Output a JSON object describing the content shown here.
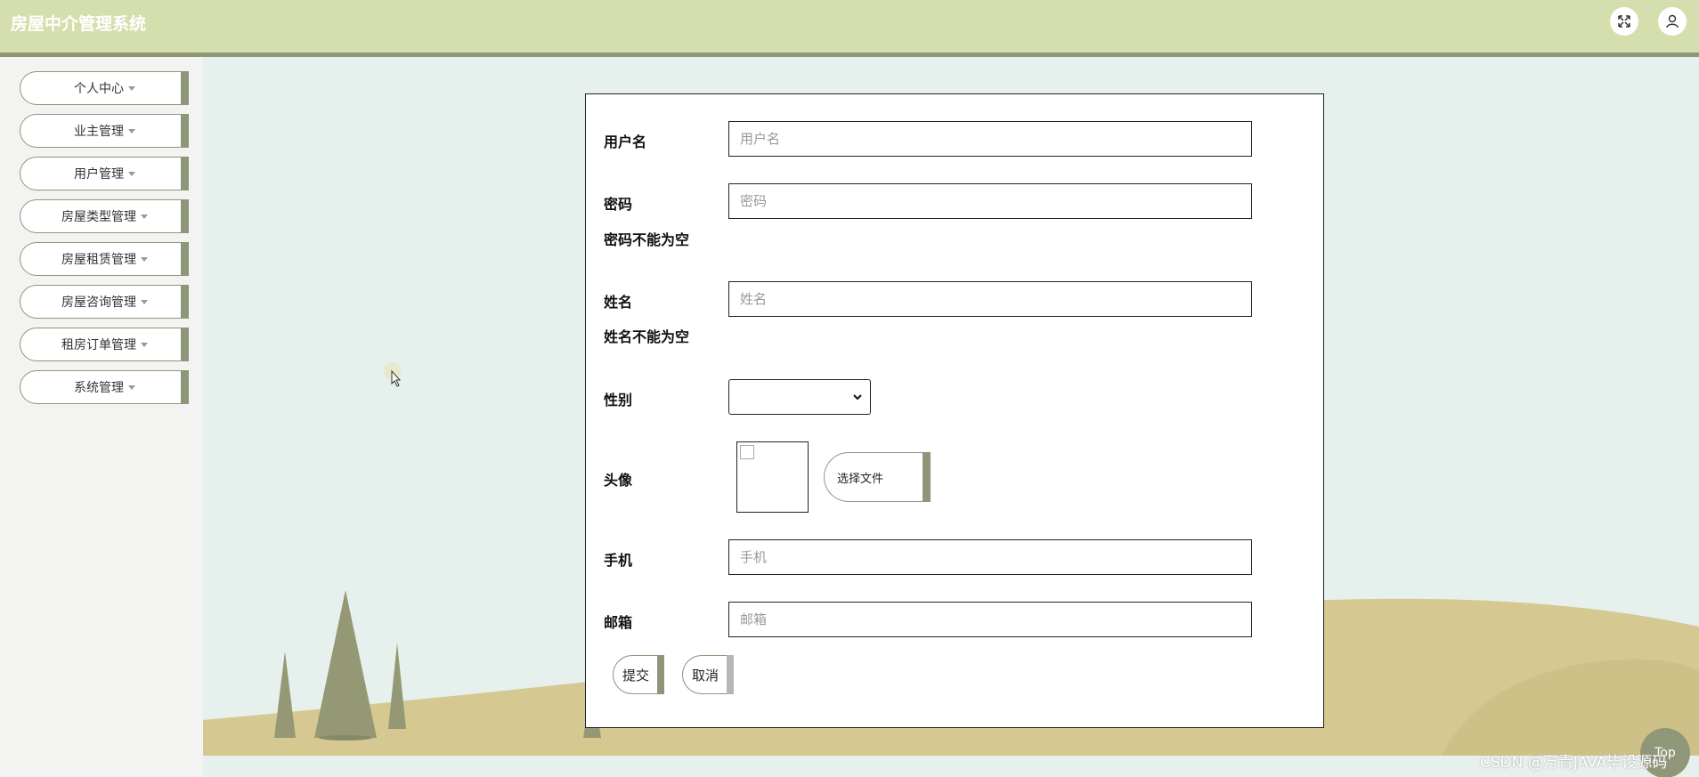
{
  "app": {
    "title": "房屋中介管理系统"
  },
  "header": {
    "fullscreen_icon": "fullscreen-icon",
    "user_icon": "user-icon"
  },
  "sidebar": {
    "items": [
      {
        "label": "个人中心"
      },
      {
        "label": "业主管理"
      },
      {
        "label": "用户管理"
      },
      {
        "label": "房屋类型管理"
      },
      {
        "label": "房屋租赁管理"
      },
      {
        "label": "房屋咨询管理"
      },
      {
        "label": "租房订单管理"
      },
      {
        "label": "系统管理"
      }
    ]
  },
  "form": {
    "username": {
      "label": "用户名",
      "placeholder": "用户名",
      "value": ""
    },
    "password": {
      "label": "密码",
      "placeholder": "密码",
      "value": "",
      "error": "密码不能为空"
    },
    "name": {
      "label": "姓名",
      "placeholder": "姓名",
      "value": "",
      "error": "姓名不能为空"
    },
    "gender": {
      "label": "性别",
      "value": ""
    },
    "avatar": {
      "label": "头像",
      "choose_file": "选择文件"
    },
    "phone": {
      "label": "手机",
      "placeholder": "手机",
      "value": ""
    },
    "email": {
      "label": "邮箱",
      "placeholder": "邮箱",
      "value": ""
    },
    "submit": "提交",
    "cancel": "取消"
  },
  "footer": {
    "watermark": "CSDN @万青JAVA毕设源码",
    "top": "Top"
  },
  "colors": {
    "header_bg": "#d5dfad",
    "accent": "#8e967a",
    "page_bg": "#e6f0ec",
    "hill": "#d6c891",
    "tree": "#949874"
  }
}
